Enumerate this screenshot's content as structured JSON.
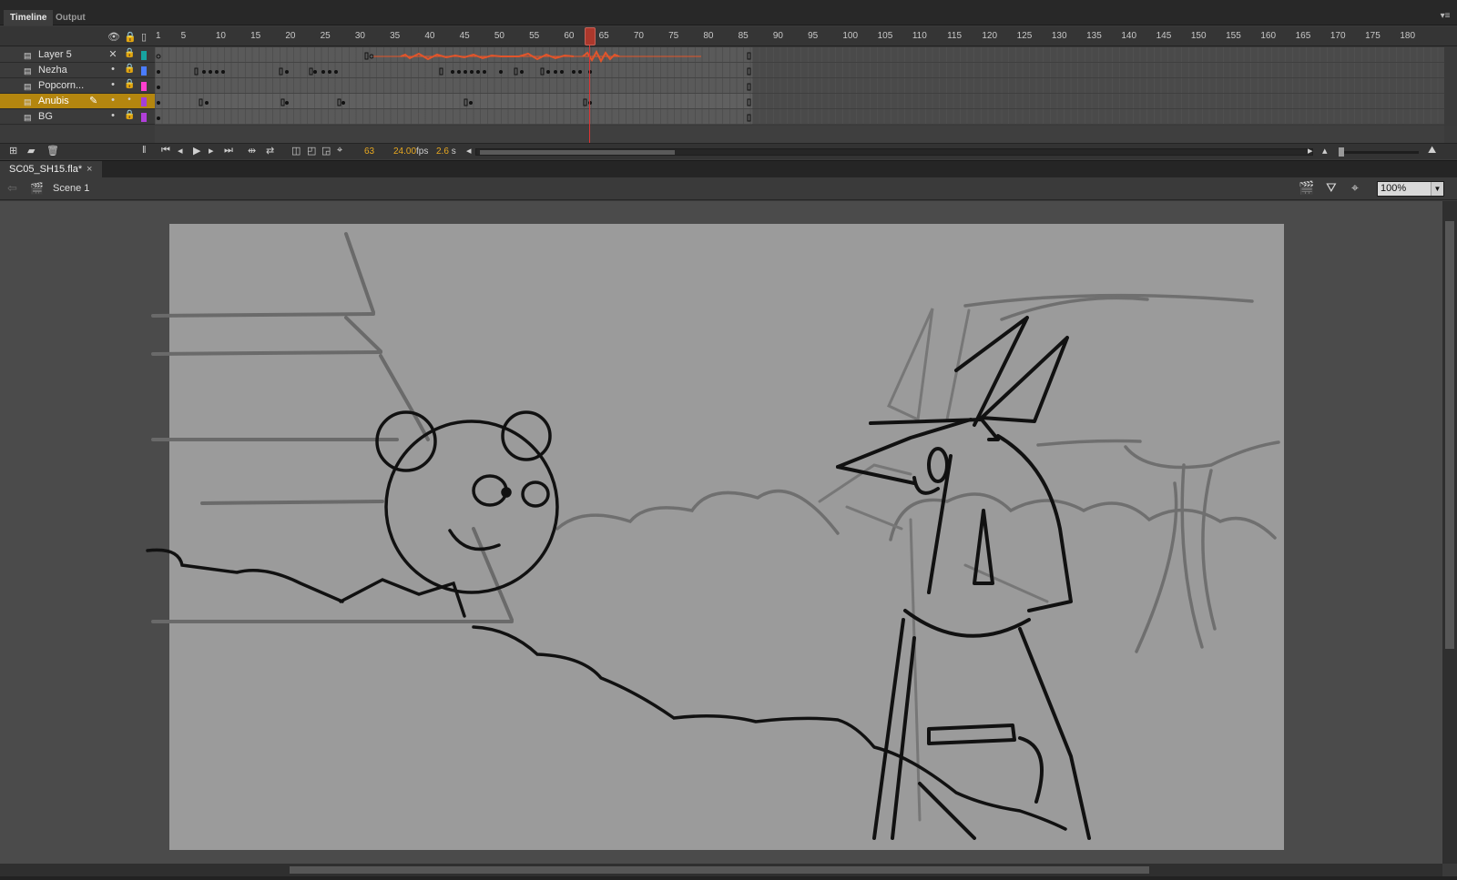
{
  "panel_tabs": [
    "Timeline",
    "Output"
  ],
  "panel_menu_icon": "panel-menu-icon",
  "ruler": {
    "first_label": "1",
    "labels": [
      "5",
      "10",
      "15",
      "20",
      "25",
      "30",
      "35",
      "40",
      "45",
      "50",
      "55",
      "60",
      "65",
      "70",
      "75",
      "80",
      "85",
      "90",
      "95",
      "100",
      "105",
      "110",
      "115",
      "120",
      "125",
      "130",
      "135",
      "140",
      "145",
      "150",
      "155",
      "160",
      "165",
      "170",
      "175",
      "180"
    ]
  },
  "layers": [
    {
      "name": "Layer 5",
      "color": "#17a3a0",
      "selected": false,
      "eye": "✕",
      "lock": "🔒"
    },
    {
      "name": "Nezha",
      "color": "#4a7cff",
      "selected": false,
      "eye": "•",
      "lock": "🔒"
    },
    {
      "name": "Popcorn...",
      "color": "#ff3fd0",
      "selected": false,
      "eye": "•",
      "lock": "🔒"
    },
    {
      "name": "Anubis",
      "color": "#a43fd9",
      "selected": true,
      "eye": "•",
      "lock": "•"
    },
    {
      "name": "BG",
      "color": "#b13fd9",
      "selected": false,
      "eye": "•",
      "lock": "🔒"
    }
  ],
  "playback": {
    "current_frame": "63",
    "fps_value": "24.00",
    "fps_unit": "fps",
    "time_value": "2.6",
    "time_unit": "s"
  },
  "document_tab": {
    "title": "SC05_SH15.fla*",
    "close": "×"
  },
  "edit_bar": {
    "scene": "Scene 1",
    "zoom": "100%"
  },
  "icons": {
    "eye_header": "eye-icon",
    "lock_header": "lock-icon",
    "outline_header": "outline-icon",
    "layer": "layer-icon",
    "pencil": "pencil-icon"
  }
}
